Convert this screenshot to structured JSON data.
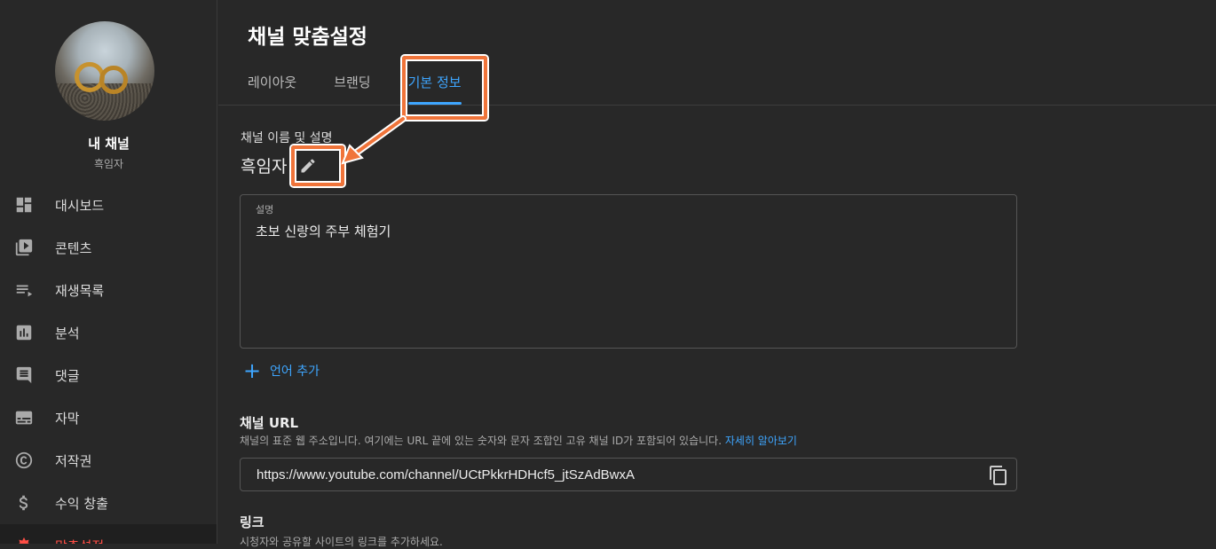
{
  "sidebar": {
    "channel_name": "내 채널",
    "channel_handle": "흑임자",
    "items": [
      {
        "label": "대시보드",
        "icon": "dashboard-icon"
      },
      {
        "label": "콘텐츠",
        "icon": "content-icon"
      },
      {
        "label": "재생목록",
        "icon": "playlist-icon"
      },
      {
        "label": "분석",
        "icon": "analytics-icon"
      },
      {
        "label": "댓글",
        "icon": "comments-icon"
      },
      {
        "label": "자막",
        "icon": "subtitles-icon"
      },
      {
        "label": "저작권",
        "icon": "copyright-icon"
      },
      {
        "label": "수익 창출",
        "icon": "monetization-icon"
      },
      {
        "label": "맞춤설정",
        "icon": "customization-icon",
        "active": true
      }
    ]
  },
  "header": {
    "title": "채널 맞춤설정",
    "tabs": [
      {
        "label": "레이아웃"
      },
      {
        "label": "브랜딩"
      },
      {
        "label": "기본 정보",
        "active": true
      }
    ]
  },
  "basic_info": {
    "name_section_label": "채널 이름 및 설명",
    "channel_name": "흑임자",
    "description_label": "설명",
    "description_value": "초보 신랑의 주부 체험기",
    "add_language": "언어 추가",
    "url_title": "채널 URL",
    "url_help": "채널의 표준 웹 주소입니다. 여기에는 URL 끝에 있는 숫자와 문자 조합인 고유 채널 ID가 포함되어 있습니다.",
    "url_help_link": "자세히 알아보기",
    "url_value": "https://www.youtube.com/channel/UCtPkkrHDHcf5_jtSzAdBwxA",
    "link_title": "링크",
    "link_help": "시청자와 공유할 사이트의 링크를 추가하세요."
  },
  "colors": {
    "background": "#282828",
    "accent": "#3ea6ff",
    "active_nav": "#ff4e45",
    "annotation": "#f0743a"
  }
}
